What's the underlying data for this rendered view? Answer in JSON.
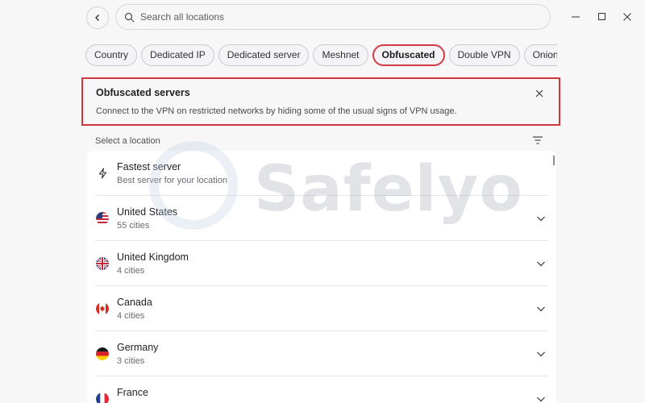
{
  "search": {
    "placeholder": "Search all locations"
  },
  "chips": [
    {
      "label": "Country"
    },
    {
      "label": "Dedicated IP"
    },
    {
      "label": "Dedicated server"
    },
    {
      "label": "Meshnet"
    },
    {
      "label": "Obfuscated",
      "active": true
    },
    {
      "label": "Double VPN"
    },
    {
      "label": "Onion Over VPN"
    }
  ],
  "notice": {
    "title": "Obfuscated servers",
    "description": "Connect to the VPN on restricted networks by hiding some of the usual signs of VPN usage."
  },
  "locations": {
    "label": "Select a location",
    "fastest": {
      "name": "Fastest server",
      "sub": "Best server for your location"
    },
    "countries": [
      {
        "name": "United States",
        "sub": "55 cities",
        "flag": "us-flag"
      },
      {
        "name": "United Kingdom",
        "sub": "4 cities",
        "flag": "uk-flag"
      },
      {
        "name": "Canada",
        "sub": "4 cities",
        "flag": "ca-flag"
      },
      {
        "name": "Germany",
        "sub": "3 cities",
        "flag": "de-flag"
      },
      {
        "name": "France",
        "sub": "",
        "flag": "fr-flag"
      }
    ]
  },
  "watermark": {
    "text": "Safelyo"
  },
  "colors": {
    "highlight": "#d0353f",
    "background": "#f7f7f8"
  }
}
